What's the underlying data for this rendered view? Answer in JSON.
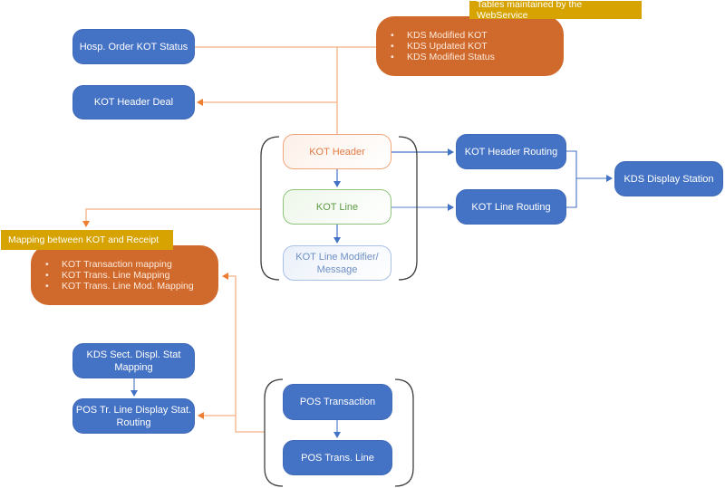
{
  "diagram": {
    "nodes": {
      "hosp_order_kot_status": "Hosp. Order KOT Status",
      "kot_header_deal": "KOT Header Deal",
      "kot_header": "KOT Header",
      "kot_line": "KOT Line",
      "kot_line_modifier_line1": "KOT Line Modifier/",
      "kot_line_modifier_line2": "Message",
      "kot_header_routing": "KOT Header Routing",
      "kot_line_routing": "KOT Line Routing",
      "kds_display_station": "KDS Display Station",
      "kds_sect_displ_line1": "KDS Sect. Displ. Stat",
      "kds_sect_displ_line2": "Mapping",
      "pos_tr_line_display_line1": "POS Tr. Line Display Stat.",
      "pos_tr_line_display_line2": "Routing",
      "pos_transaction": "POS Transaction",
      "pos_trans_line": "POS Trans. Line"
    },
    "webservice_group": {
      "label": "Tables maintained by the WebService",
      "items": [
        "KDS Modified KOT",
        "KDS Updated KOT",
        "KDS Modified Status"
      ]
    },
    "mapping_group": {
      "label": "Mapping between KOT and Receipt",
      "items": [
        "KOT Transaction mapping",
        "KOT Trans. Line Mapping",
        "KOT Trans. Line Mod. Mapping"
      ]
    },
    "colors": {
      "primary_blue": "#4472c4",
      "accent_orange": "#d06a2c",
      "label_gold": "#d6a300",
      "connector_orange": "#f4b183",
      "arrow_orange": "#ed7d31",
      "connector_blue": "#4472c4"
    }
  }
}
